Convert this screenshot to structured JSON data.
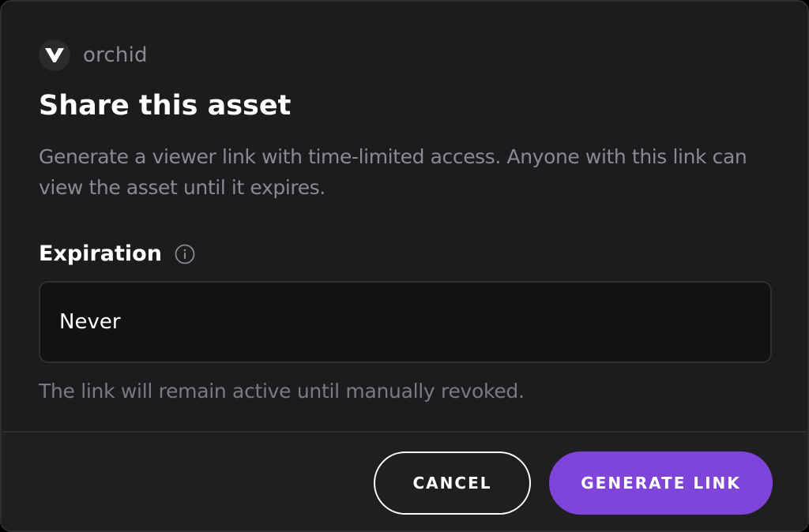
{
  "brand": {
    "name": "orchid",
    "logo_icon": "orchid-logo-icon"
  },
  "dialog": {
    "title": "Share this asset",
    "description": "Generate a viewer link with time-limited access. Anyone with this link can view the asset until it expires."
  },
  "expiration": {
    "label": "Expiration",
    "info_icon": "info-icon",
    "selected_value": "Never",
    "helper_text": "The link will remain active until manually revoked."
  },
  "actions": {
    "cancel_label": "CANCEL",
    "generate_label": "GENERATE LINK"
  },
  "colors": {
    "background": "#1c1c1f",
    "accent": "#7f44d9",
    "input_background": "#121212"
  }
}
